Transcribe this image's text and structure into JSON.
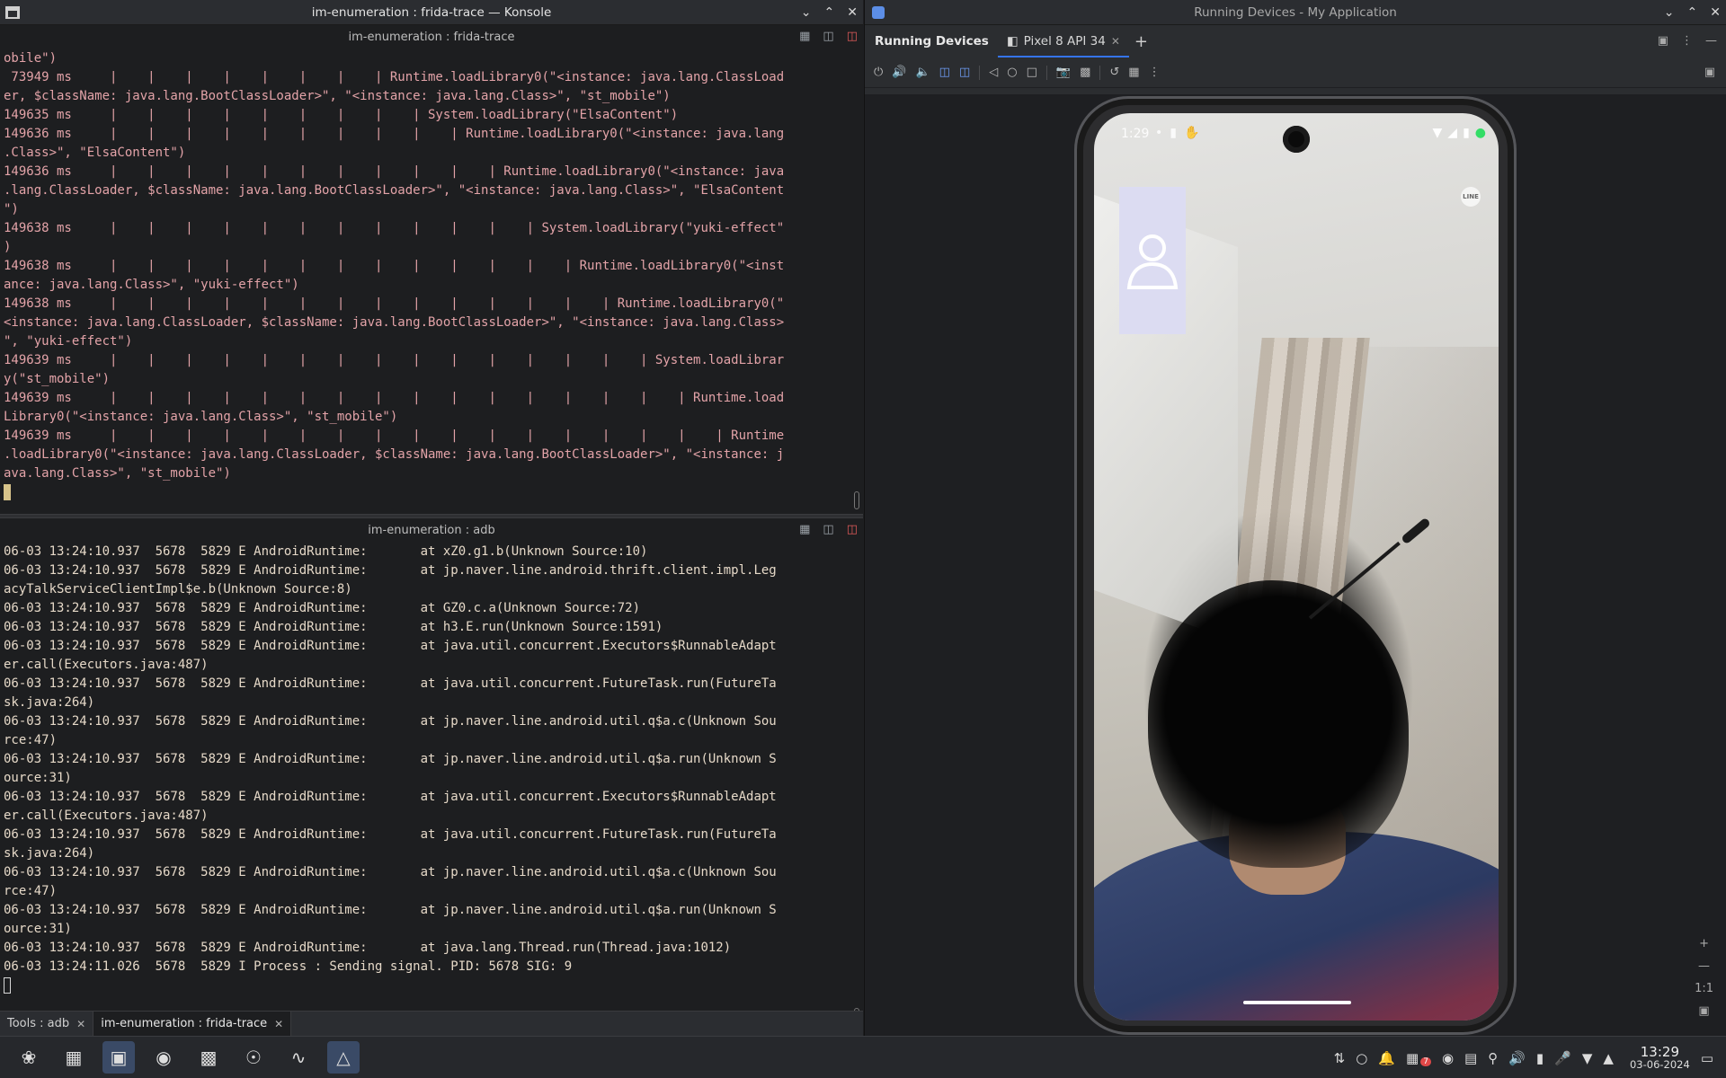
{
  "konsole": {
    "title": "im-enumeration : frida-trace — Konsole",
    "pane_top": {
      "title": "im-enumeration : frida-trace",
      "lines": [
        "obile\")",
        " 73949 ms     |    |    |    |    |    |    |    | Runtime.loadLibrary0(\"<instance: java.lang.ClassLoad",
        "er, $className: java.lang.BootClassLoader>\", \"<instance: java.lang.Class>\", \"st_mobile\")",
        "149635 ms     |    |    |    |    |    |    |    |    | System.loadLibrary(\"ElsaContent\")",
        "149636 ms     |    |    |    |    |    |    |    |    |    | Runtime.loadLibrary0(\"<instance: java.lang",
        ".Class>\", \"ElsaContent\")",
        "149636 ms     |    |    |    |    |    |    |    |    |    |    | Runtime.loadLibrary0(\"<instance: java",
        ".lang.ClassLoader, $className: java.lang.BootClassLoader>\", \"<instance: java.lang.Class>\", \"ElsaContent",
        "\")",
        "149638 ms     |    |    |    |    |    |    |    |    |    |    |    | System.loadLibrary(\"yuki-effect\"",
        ")",
        "149638 ms     |    |    |    |    |    |    |    |    |    |    |    |    | Runtime.loadLibrary0(\"<inst",
        "ance: java.lang.Class>\", \"yuki-effect\")",
        "149638 ms     |    |    |    |    |    |    |    |    |    |    |    |    |    | Runtime.loadLibrary0(\"",
        "<instance: java.lang.ClassLoader, $className: java.lang.BootClassLoader>\", \"<instance: java.lang.Class>",
        "\", \"yuki-effect\")",
        "149639 ms     |    |    |    |    |    |    |    |    |    |    |    |    |    |    | System.loadLibrar",
        "y(\"st_mobile\")",
        "149639 ms     |    |    |    |    |    |    |    |    |    |    |    |    |    |    |    | Runtime.load",
        "Library0(\"<instance: java.lang.Class>\", \"st_mobile\")",
        "149639 ms     |    |    |    |    |    |    |    |    |    |    |    |    |    |    |    |    | Runtime",
        ".loadLibrary0(\"<instance: java.lang.ClassLoader, $className: java.lang.BootClassLoader>\", \"<instance: j",
        "ava.lang.Class>\", \"st_mobile\")"
      ]
    },
    "pane_bottom": {
      "title": "im-enumeration : adb",
      "lines": [
        "06-03 13:24:10.937  5678  5829 E AndroidRuntime:       at xZ0.g1.b(Unknown Source:10)",
        "06-03 13:24:10.937  5678  5829 E AndroidRuntime:       at jp.naver.line.android.thrift.client.impl.Leg",
        "acyTalkServiceClientImpl$e.b(Unknown Source:8)",
        "06-03 13:24:10.937  5678  5829 E AndroidRuntime:       at GZ0.c.a(Unknown Source:72)",
        "06-03 13:24:10.937  5678  5829 E AndroidRuntime:       at h3.E.run(Unknown Source:1591)",
        "06-03 13:24:10.937  5678  5829 E AndroidRuntime:       at java.util.concurrent.Executors$RunnableAdapt",
        "er.call(Executors.java:487)",
        "06-03 13:24:10.937  5678  5829 E AndroidRuntime:       at java.util.concurrent.FutureTask.run(FutureTa",
        "sk.java:264)",
        "06-03 13:24:10.937  5678  5829 E AndroidRuntime:       at jp.naver.line.android.util.q$a.c(Unknown Sou",
        "rce:47)",
        "06-03 13:24:10.937  5678  5829 E AndroidRuntime:       at jp.naver.line.android.util.q$a.run(Unknown S",
        "ource:31)",
        "06-03 13:24:10.937  5678  5829 E AndroidRuntime:       at java.util.concurrent.Executors$RunnableAdapt",
        "er.call(Executors.java:487)",
        "06-03 13:24:10.937  5678  5829 E AndroidRuntime:       at java.util.concurrent.FutureTask.run(FutureTa",
        "sk.java:264)",
        "06-03 13:24:10.937  5678  5829 E AndroidRuntime:       at jp.naver.line.android.util.q$a.c(Unknown Sou",
        "rce:47)",
        "06-03 13:24:10.937  5678  5829 E AndroidRuntime:       at jp.naver.line.android.util.q$a.run(Unknown S",
        "ource:31)",
        "06-03 13:24:10.937  5678  5829 E AndroidRuntime:       at java.lang.Thread.run(Thread.java:1012)",
        "06-03 13:24:11.026  5678  5829 I Process : Sending signal. PID: 5678 SIG: 9"
      ]
    },
    "tabs": [
      {
        "label": "Tools : adb"
      },
      {
        "label": "im-enumeration : frida-trace"
      }
    ]
  },
  "studio": {
    "title": "Running Devices - My Application",
    "panel_title": "Running Devices",
    "device_tab": "Pixel 8 API 34",
    "phone": {
      "status_time": "1:29",
      "badge": "LINE"
    },
    "zoom_label": "1:1"
  },
  "taskbar": {
    "clock_time": "13:29",
    "clock_date": "03-06-2024",
    "notification_count": "7"
  },
  "colors": {
    "frida_text": "#e3a3a8",
    "adb_text": "#e6d9c8",
    "accent_blue": "#3574f0",
    "pip_tile": "#dcdcf2"
  }
}
